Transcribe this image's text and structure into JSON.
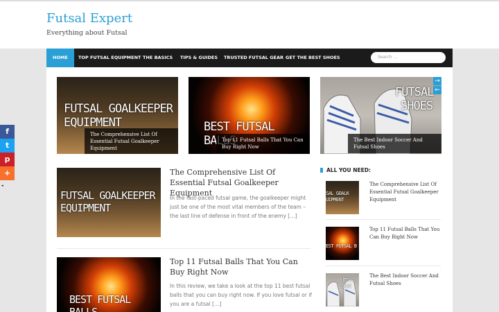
{
  "site": {
    "title": "Futsal Expert",
    "tagline": "Everything about Futsal"
  },
  "nav": {
    "items": [
      {
        "label": "HOME",
        "active": true
      },
      {
        "label": "TOP FUTSAL EQUIPMENT"
      },
      {
        "label": "THE BASICS"
      },
      {
        "label": "TIPS & GUIDES"
      },
      {
        "label": "TRUSTED FUTSAL GEAR"
      },
      {
        "label": "GET THE BEST SHOES"
      }
    ],
    "search_placeholder": "Search ..."
  },
  "slider": {
    "slides": [
      {
        "image_text_line1": "FUTSAL GOALKEEPER",
        "image_text_line2": "EQUIPMENT",
        "caption": "The Comprehensive List Of Essential Futsal Goalkeeper Equipment"
      },
      {
        "image_text_line1": "BEST FUTSAL BALLS",
        "caption": "Top 11 Futsal Balls That You Can Buy Right Now"
      },
      {
        "image_text_line1": "FUTSAL",
        "image_text_line2": "SHOES",
        "caption": "The Best Indoor Soccer And Futsal Shoes"
      }
    ],
    "next_arrow": "→",
    "prev_arrow": "←"
  },
  "posts": [
    {
      "thumb_line1": "FUTSAL GOALKEEPER",
      "thumb_line2": "EQUIPMENT",
      "title": "The Comprehensive List Of Essential Futsal Goalkeeper Equipment",
      "excerpt": "In the fast-paced futsal game, the goalkeeper might just be one of the most vital members of the team – the last line of defense in front of the enemy […]"
    },
    {
      "thumb_line1": "BEST FUTSAL BALLS",
      "title": "Top 11 Futsal Balls That You Can Buy Right Now",
      "excerpt": "In this review, we take a look at the top 11 best futsal balls that you can buy right now. If you love futsal or if you are a futsal […]"
    }
  ],
  "sidebar": {
    "title": "ALL YOU NEED:",
    "items": [
      {
        "thumb_line1": "SAL GOALK",
        "thumb_line2": "UIPMENT",
        "label": "The Comprehensive List Of Essential Futsal Goalkeeper Equipment"
      },
      {
        "thumb_line1": "EST FUTSAL B",
        "label": "Top 11 Futsal Balls That You Can Buy Right Now"
      },
      {
        "thumb_line1": "UTSAL",
        "thumb_line2": "SHOE",
        "label": "The Best Indoor Soccer And Futsal Shoes"
      }
    ]
  },
  "share": {
    "facebook_icon": "f",
    "twitter_icon": "t",
    "pinterest_icon": "p",
    "more_icon": "+",
    "toggle_icon": "◂"
  },
  "colors": {
    "accent": "#2a9fd6",
    "nav_bg": "#1b1b1b",
    "facebook": "#3b5998",
    "twitter": "#1da1f2",
    "pinterest": "#cb2027",
    "more": "#f8712c"
  }
}
